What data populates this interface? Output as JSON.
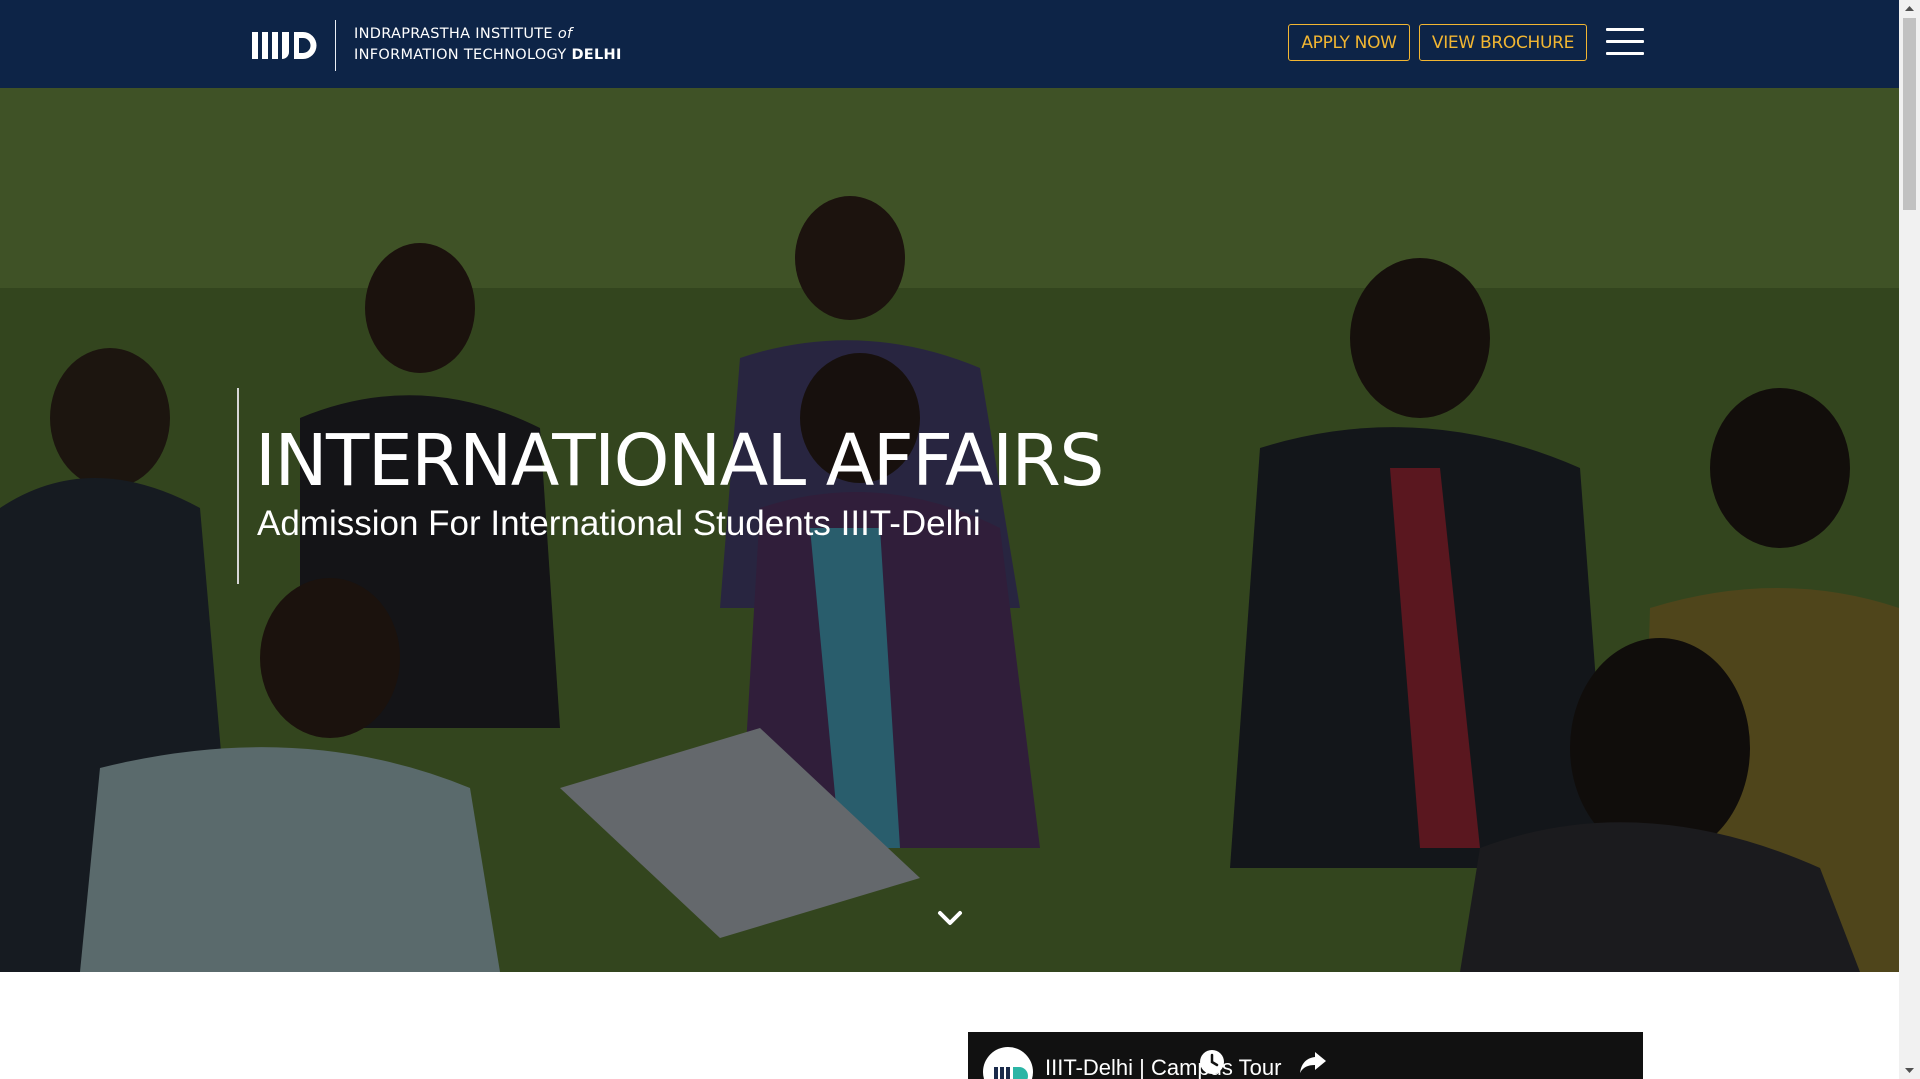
{
  "header": {
    "logo_line1_a": "INDRAPRASTHA INSTITUTE",
    "logo_line1_b": "of",
    "logo_line2_a": "INFORMATION TECHNOLOGY",
    "logo_line2_b": "DELHI",
    "apply_label": "APPLY NOW",
    "brochure_label": "VIEW BROCHURE",
    "background_color": "#0d2447",
    "accent_color": "#f2b632"
  },
  "hero": {
    "title": "INTERNATIONAL AFFAIRS",
    "subtitle": "Admission For International Students IIIT-Delhi"
  },
  "video": {
    "title": "IIIT-Delhi | Campus Tour"
  },
  "icons": {
    "menu": "hamburger-menu-icon",
    "scroll": "chevron-down-icon",
    "watch_later": "clock-icon",
    "share": "share-icon"
  }
}
